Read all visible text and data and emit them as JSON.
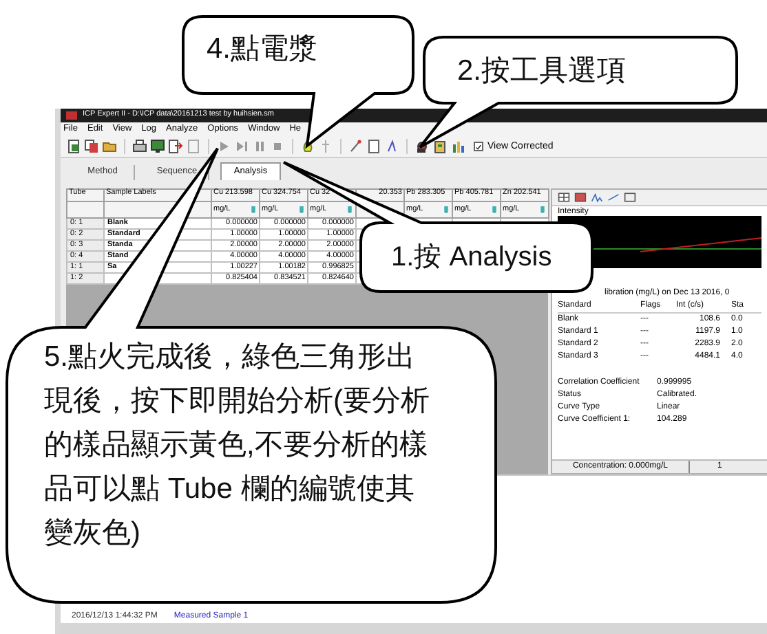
{
  "window": {
    "title": "ICP Expert II - D:\\ICP data\\20161213 test by huihsien.sm"
  },
  "menu": [
    "File",
    "Edit",
    "View",
    "Log",
    "Analyze",
    "Options",
    "Window",
    "He"
  ],
  "toolbar": {
    "view_corrected": {
      "label": "View Corrected",
      "checked": true
    }
  },
  "tabs": [
    {
      "label": "Method",
      "selected": false
    },
    {
      "label": "Sequence",
      "selected": false
    },
    {
      "label": "Analysis",
      "selected": true
    }
  ],
  "results_table": {
    "columns": [
      {
        "name": "Tube"
      },
      {
        "name": "Sample Labels"
      },
      {
        "name": "Cu 213.598",
        "unit": "mg/L"
      },
      {
        "name": "Cu 324.754",
        "unit": "mg/L"
      },
      {
        "name": "Cu 32",
        "unit": "mg/L"
      },
      {
        "name": "20.353"
      },
      {
        "name": "Pb 283.305",
        "unit": "mg/L"
      },
      {
        "name": "Pb 405.781",
        "unit": "mg/L"
      },
      {
        "name": "Zn 202.541",
        "unit": "mg/L"
      }
    ],
    "rows": [
      {
        "tube": "0: 1",
        "label": "Blank",
        "values": [
          "0.000000",
          "0.000000",
          "0.000000"
        ]
      },
      {
        "tube": "0: 2",
        "label": "Standard",
        "values": [
          "1.00000",
          "1.00000",
          "1.00000"
        ]
      },
      {
        "tube": "0: 3",
        "label": "Standa",
        "values": [
          "2.00000",
          "2.00000",
          "2.00000"
        ]
      },
      {
        "tube": "0: 4",
        "label": "Stand",
        "values": [
          "4.00000",
          "4.00000",
          "4.00000"
        ]
      },
      {
        "tube": "1: 1",
        "label": "Sa",
        "values": [
          "1.00227",
          "1.00182",
          "0.996825"
        ]
      },
      {
        "tube": "1: 2",
        "values": [
          "0.825404",
          "0.834521",
          "0.824640"
        ]
      }
    ]
  },
  "calibration_panel": {
    "plot_label": "Intensity",
    "header": "libration (mg/L) on Dec 13 2016, 0",
    "columns": [
      "Standard",
      "Flags",
      "Int (c/s)",
      "Sta"
    ],
    "rows": [
      [
        "Blank",
        "---",
        "108.6",
        "0.0"
      ],
      [
        "Standard 1",
        "---",
        "1197.9",
        "1.0"
      ],
      [
        "Standard 2",
        "---",
        "2283.9",
        "2.0"
      ],
      [
        "Standard 3",
        "---",
        "4484.1",
        "4.0"
      ]
    ],
    "details": [
      {
        "label": "Correlation Coefficient",
        "value": "0.999995"
      },
      {
        "label": "Status",
        "value": "Calibrated."
      },
      {
        "label": "Curve Type",
        "value": "Linear"
      },
      {
        "label": "Curve Coefficient 1:",
        "value": "104.289"
      }
    ],
    "footer": [
      "Concentration: 0.000mg/L",
      "1"
    ]
  },
  "log": [
    {
      "time": "2016/12/13 1:44:32 PM",
      "message": "Measured Sample 1"
    }
  ],
  "callouts": [
    {
      "text": "4.點電漿"
    },
    {
      "text": "2.按工具選項"
    },
    {
      "text": "1.按 Analysis"
    },
    {
      "text": "5.點火完成後，綠色三角形出現後，按下即開始分析(要分析的樣品顯示黃色,不要分析的樣品可以點 Tube 欄的編號使其變灰色)"
    }
  ]
}
